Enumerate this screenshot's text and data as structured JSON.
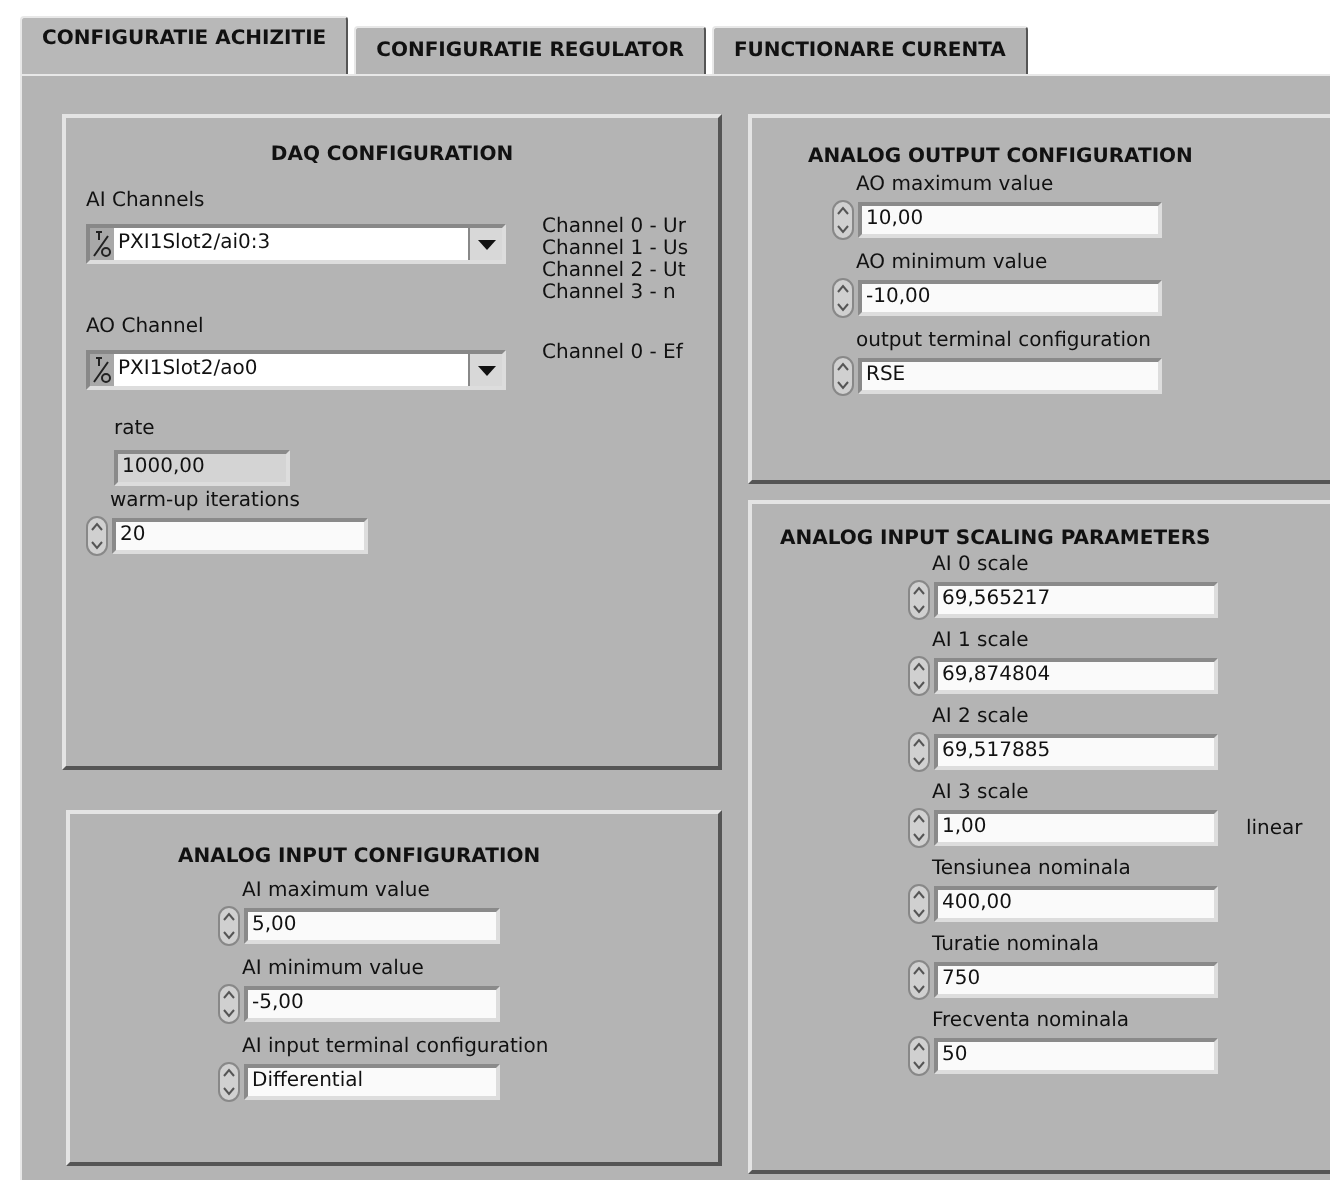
{
  "tabs": [
    {
      "label": "CONFIGURATIE ACHIZITIE",
      "selected": true
    },
    {
      "label": "CONFIGURATIE REGULATOR",
      "selected": false
    },
    {
      "label": "FUNCTIONARE CURENTA",
      "selected": false
    }
  ],
  "daq_configuration": {
    "title": "DAQ CONFIGURATION",
    "controls": [
      {
        "kind": "io",
        "label": "AI Channels",
        "value": "PXI1Slot2/ai0:3",
        "notes": [
          "Channel 0 - Ur",
          "Channel 1 - Us",
          "Channel 2 - Ut",
          "Channel 3 - n"
        ]
      },
      {
        "kind": "io",
        "label": "AO Channel",
        "value": "PXI1Slot2/ao0",
        "notes": [
          "Channel 0 - Ef"
        ]
      },
      {
        "kind": "indicator",
        "label": "rate",
        "value": "1000,00"
      },
      {
        "kind": "numeric",
        "label": "warm-up iterations",
        "value": "20"
      }
    ]
  },
  "analog_input_configuration": {
    "title": "ANALOG INPUT CONFIGURATION",
    "controls": [
      {
        "kind": "numeric",
        "label": "AI maximum value",
        "value": "5,00"
      },
      {
        "kind": "numeric",
        "label": "AI minimum value",
        "value": "-5,00"
      },
      {
        "kind": "numeric",
        "label": "AI input terminal configuration",
        "value": "Differential"
      }
    ]
  },
  "analog_output_configuration": {
    "title": "ANALOG OUTPUT CONFIGURATION",
    "controls": [
      {
        "kind": "numeric",
        "label": "AO maximum value",
        "value": "10,00"
      },
      {
        "kind": "numeric",
        "label": "AO minimum value",
        "value": "-10,00"
      },
      {
        "kind": "numeric",
        "label": "output terminal configuration",
        "value": "RSE"
      }
    ]
  },
  "analog_input_scaling_parameters": {
    "title": "ANALOG INPUT SCALING PARAMETERS",
    "controls": [
      {
        "kind": "numeric",
        "label": "AI 0 scale",
        "value": "69,565217"
      },
      {
        "kind": "numeric",
        "label": "AI 1 scale",
        "value": "69,874804"
      },
      {
        "kind": "numeric",
        "label": "AI 2 scale",
        "value": "69,517885"
      },
      {
        "kind": "numeric",
        "label": "AI 3 scale",
        "value": "1,00",
        "unit": "linear"
      },
      {
        "kind": "numeric",
        "label": "Tensiunea nominala",
        "value": "400,00"
      },
      {
        "kind": "numeric",
        "label": "Turatie nominala",
        "value": "750"
      },
      {
        "kind": "numeric",
        "label": "Frecventa nominala",
        "value": "50"
      }
    ]
  }
}
